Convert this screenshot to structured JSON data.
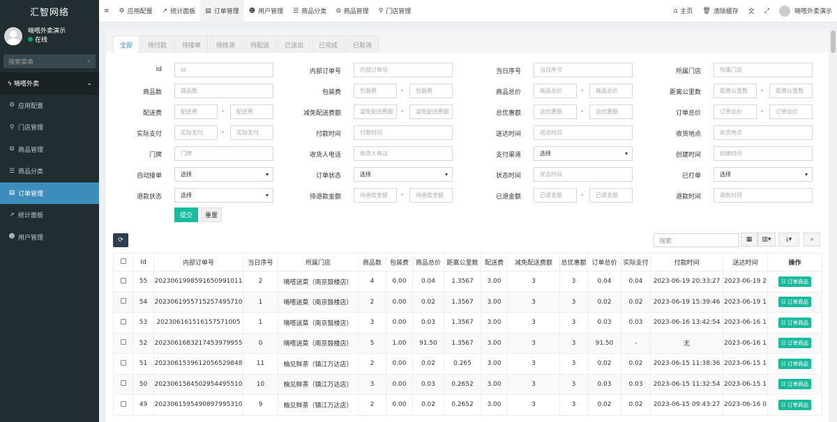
{
  "brand": "汇智网络",
  "user": {
    "name": "嘀嗒外卖演示",
    "status": "在线"
  },
  "sidebar": {
    "search_placeholder": "搜索菜单",
    "group": "嘀嗒外卖",
    "items": [
      {
        "label": "应用配置",
        "icon": "gear-icon"
      },
      {
        "label": "门店管理",
        "icon": "map-marker-icon"
      },
      {
        "label": "商品管理",
        "icon": "cubes-icon"
      },
      {
        "label": "商品分类",
        "icon": "list-icon"
      },
      {
        "label": "订单管理",
        "icon": "file-icon",
        "active": true
      },
      {
        "label": "统计面板",
        "icon": "chart-icon"
      },
      {
        "label": "用户管理",
        "icon": "users-icon"
      }
    ]
  },
  "topnav": {
    "items": [
      {
        "label": "应用配置",
        "icon": "gear-icon"
      },
      {
        "label": "统计面板",
        "icon": "chart-icon"
      },
      {
        "label": "订单管理",
        "icon": "file-icon",
        "active": true
      },
      {
        "label": "用户管理",
        "icon": "users-icon"
      },
      {
        "label": "商品分类",
        "icon": "list-icon"
      },
      {
        "label": "商品管理",
        "icon": "cubes-icon"
      },
      {
        "label": "门店管理",
        "icon": "map-marker-icon"
      }
    ],
    "home": "主页",
    "clear_cache": "清除缓存",
    "user": "嘀嗒外卖演示"
  },
  "tabs": [
    "全部",
    "待付款",
    "待接单",
    "待拣货",
    "待配送",
    "已送出",
    "已完成",
    "已取消"
  ],
  "filters": {
    "labels": [
      "Id",
      "内部订单号",
      "当日序号",
      "所属门店",
      "商品数",
      "包装费",
      "商品总价",
      "距离公里数",
      "配送费",
      "减免配送费额",
      "总优惠额",
      "订单总价",
      "实际支付",
      "付款时间",
      "送达时间",
      "收货地点",
      "门牌",
      "收货人电话",
      "支付渠道",
      "创建时间",
      "自动接单",
      "订单状态",
      "状态时间",
      "已打单",
      "退款状态",
      "待退款金额",
      "已退金额",
      "退款时间"
    ],
    "placeholders": {
      "id": "Id",
      "order_no": "内部订单号",
      "day_seq": "当日序号",
      "store": "所属门店",
      "goods_num": "商品数",
      "pack_fee_a": "包装费",
      "pack_fee_b": "包装费",
      "goods_price_a": "商品总价",
      "goods_price_b": "商品总价",
      "distance_a": "距离公里数",
      "distance_b": "距离公里数",
      "delivery_fee_a": "配送费",
      "delivery_fee_b": "配送费",
      "reduce_fee_a": "减免配送费额",
      "reduce_fee_b": "减免配送费额",
      "discount_a": "总优惠额",
      "discount_b": "总优惠额",
      "total_a": "订单总价",
      "total_b": "订单总价",
      "paid_a": "实际支付",
      "paid_b": "实际支付",
      "pay_time": "付款时间",
      "arrive_time": "送达时间",
      "address": "收货地点",
      "door": "门牌",
      "phone": "收货人电话",
      "create_time": "创建时间",
      "status_time": "状态时间",
      "refund_pending_a": "待退款金额",
      "refund_pending_b": "待退款金额",
      "refunded_a": "已退金额",
      "refunded_b": "已退金额",
      "refund_time": "退款时间"
    },
    "select_text": "选择",
    "submit": "提交",
    "reset": "重置"
  },
  "toolbar": {
    "search_placeholder": "搜索"
  },
  "table": {
    "headers": [
      "Id",
      "内部订单号",
      "当日序号",
      "所属门店",
      "商品数",
      "包装费",
      "商品总价",
      "距离公里数",
      "配送费",
      "减免配送费额",
      "总优惠额",
      "订单总价",
      "实际支付",
      "付款时间",
      "送达时间",
      "操作"
    ],
    "action_label": "订单商品",
    "rows": [
      [
        "55",
        "20230619985916509910​11",
        "2",
        "嘀嗒送菜（南京鼓楼店）",
        "4",
        "0.00",
        "0.04",
        "1.3567",
        "3.00",
        "3",
        "3",
        "0.04",
        "0.04",
        "2023-06-19 20:33:27",
        "2023-06-19 2"
      ],
      [
        "54",
        "20230619557152574957​10",
        "1",
        "嘀嗒送菜（南京鼓楼店）",
        "2",
        "0.00",
        "0.02",
        "1.3567",
        "3.00",
        "3",
        "3",
        "0.02",
        "0.02",
        "2023-06-19 15:39:46",
        "2023-06-19 1"
      ],
      [
        "53",
        "20230616151615757100​5",
        "1",
        "嘀嗒送菜（南京鼓楼店）",
        "3",
        "0.00",
        "0.03",
        "1.3567",
        "3.00",
        "3",
        "3",
        "0.03",
        "0.03",
        "2023-06-16 13:42:54",
        "2023-06-16 1"
      ],
      [
        "52",
        "2023061683217453979955",
        "0",
        "嘀嗒送菜（南京鼓楼店）",
        "5",
        "1.00",
        "91.50",
        "1.3567",
        "3.00",
        "3",
        "3",
        "91.50",
        "-",
        "无",
        "2023-06-16 1"
      ],
      [
        "51",
        "2023061539612056529848",
        "11",
        "柚见鲜茶（镇江万达店）",
        "2",
        "0.00",
        "0.02",
        "0.265",
        "3.00",
        "3",
        "3",
        "0.02",
        "0.02",
        "2023-06-15 11:38:36",
        "2023-06-15 1"
      ],
      [
        "50",
        "2023061584502954495510",
        "10",
        "柚见鲜茶（镇江万达店）",
        "3",
        "0.00",
        "0.03",
        "0.2652",
        "3.00",
        "3",
        "3",
        "0.03",
        "0.03",
        "2023-06-15 11:32:54",
        "2023-06-15 1"
      ],
      [
        "49",
        "2023061595490897995310",
        "9",
        "柚见鲜茶（镇江万达店）",
        "2",
        "0.00",
        "0.02",
        "0.2652",
        "3.00",
        "3",
        "3",
        "0.02",
        "0.02",
        "2023-06-15 09:43:27",
        "2023-06-16 0"
      ]
    ]
  }
}
